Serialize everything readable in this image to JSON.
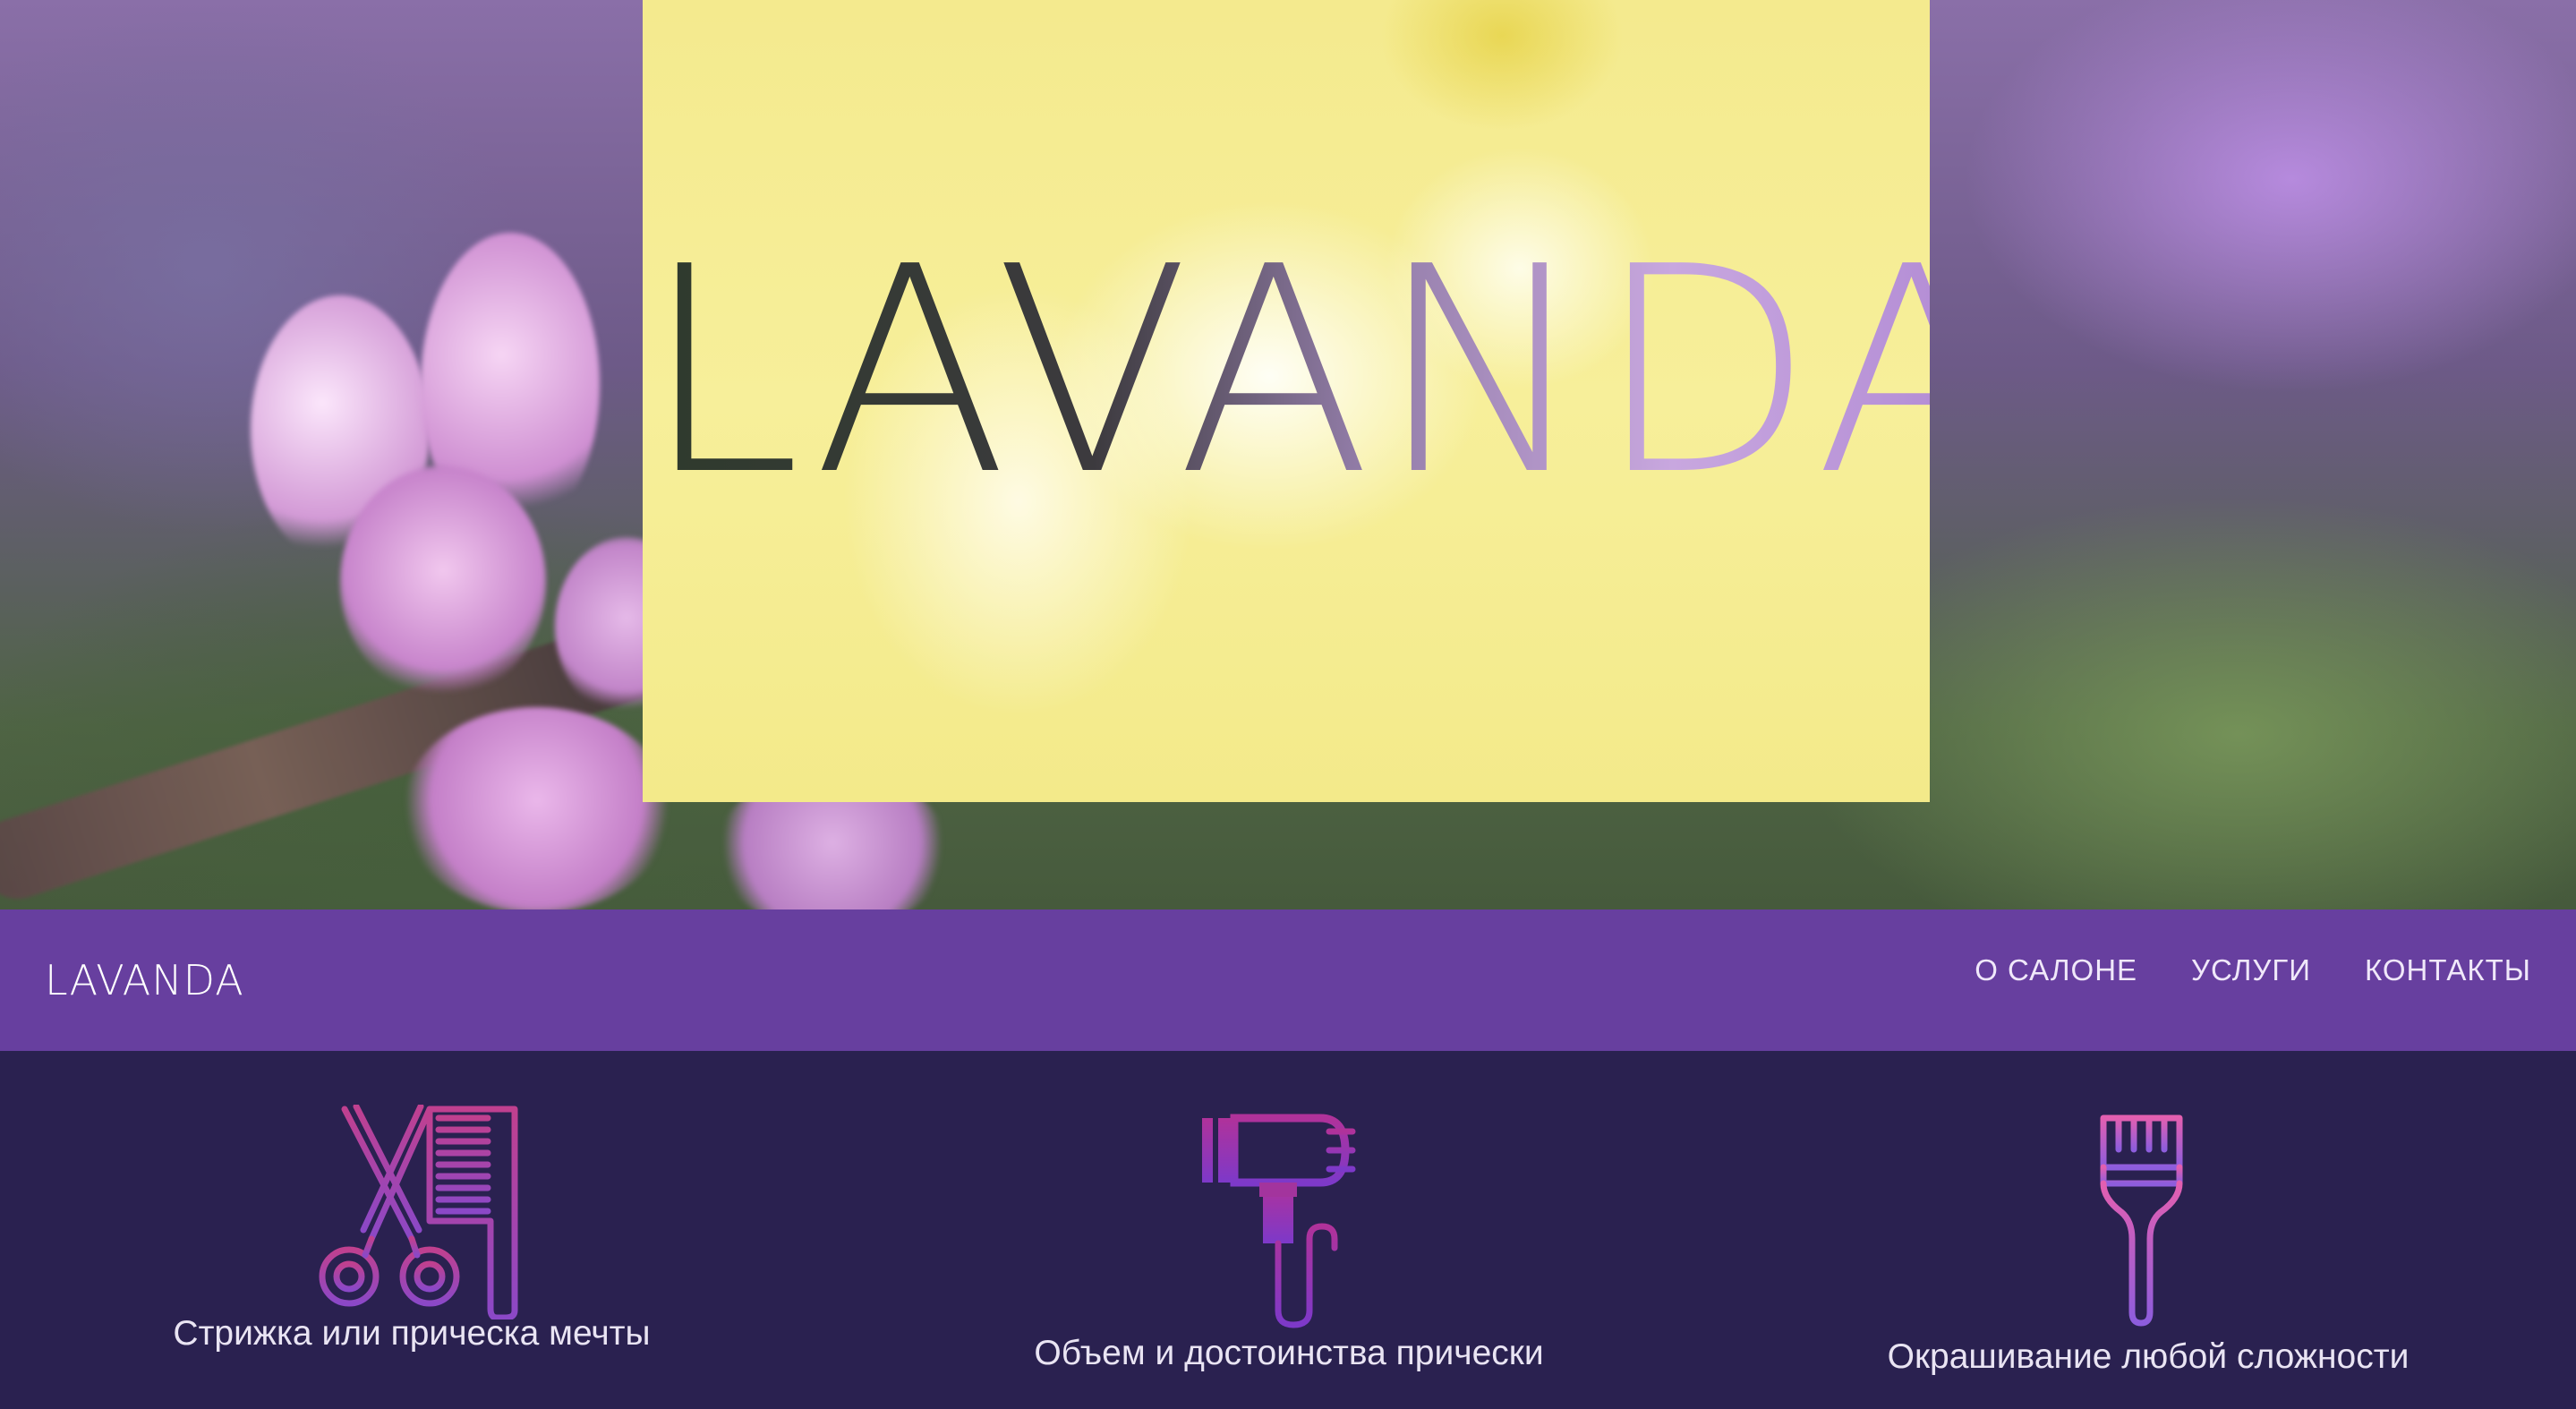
{
  "hero": {
    "title": "LAVANDA"
  },
  "navbar": {
    "brand": "LAVANDA",
    "links": [
      "О САЛОНЕ",
      "УСЛУГИ",
      "КОНТАКТЫ"
    ]
  },
  "services": [
    {
      "icon": "scissors-comb-icon",
      "label": "Стрижка или прическа мечты"
    },
    {
      "icon": "hair-dryer-icon",
      "label": "Объем и достоинства прически"
    },
    {
      "icon": "dye-brush-icon",
      "label": "Окрашивание любой сложности"
    }
  ],
  "colors": {
    "navbar": "#673f9f",
    "services_bg": "#2a2150",
    "icon_pink": "#d35fb8",
    "icon_purple": "#8e3fd0"
  }
}
